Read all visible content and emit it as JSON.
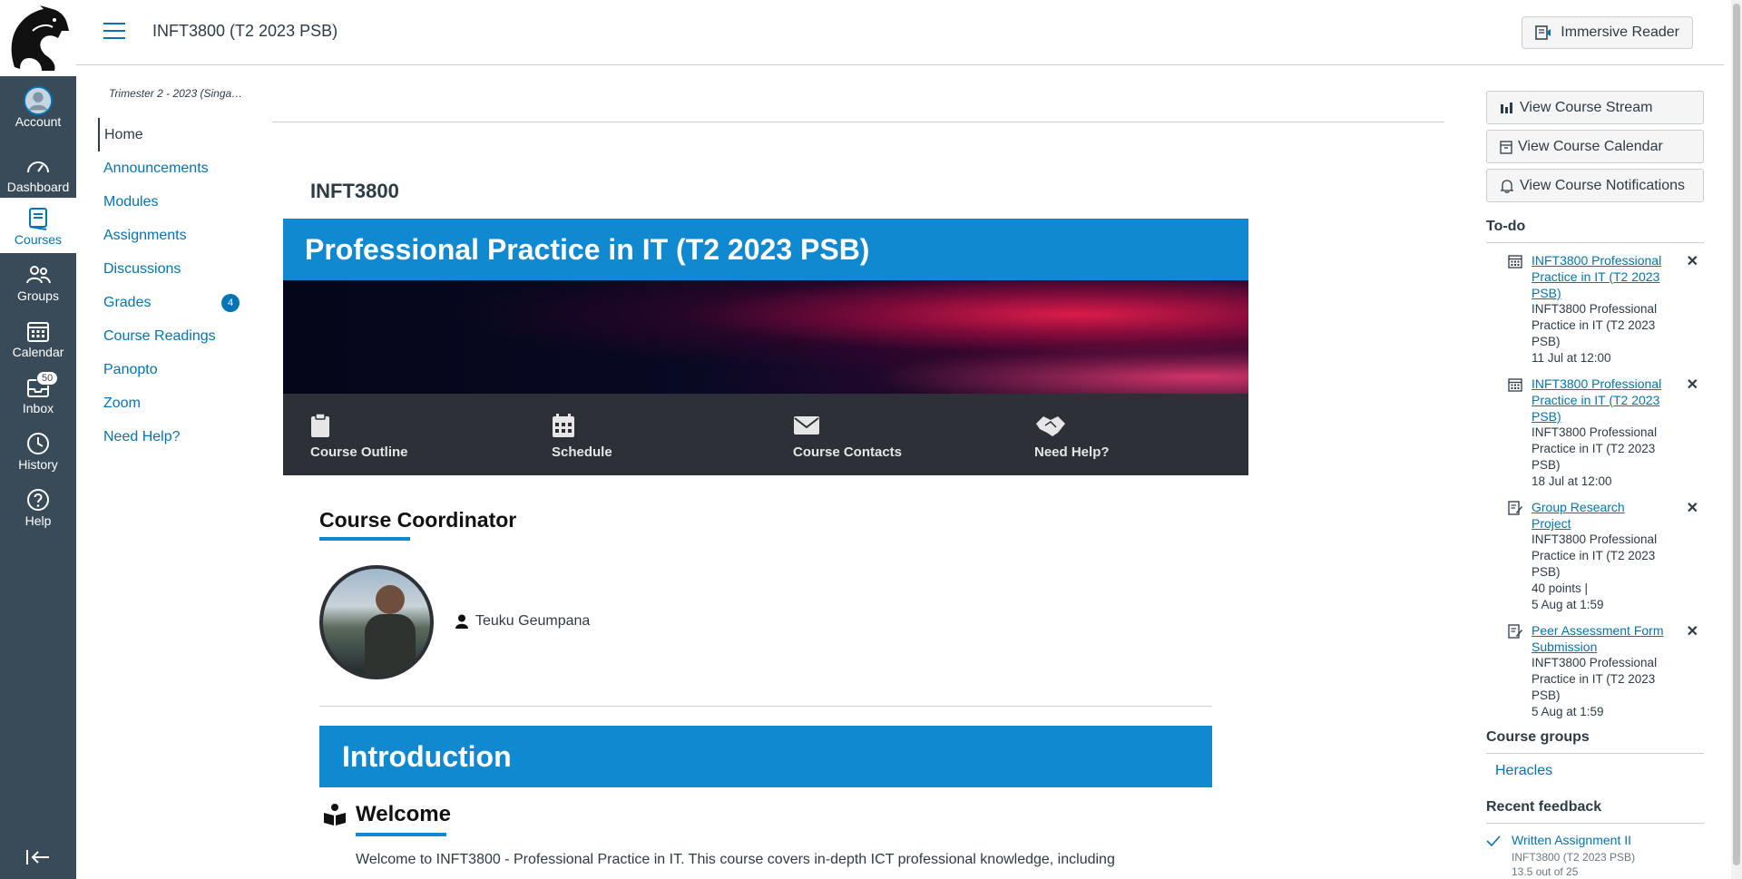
{
  "global_nav": {
    "items": [
      {
        "label": "Account",
        "icon": "account-avatar-icon"
      },
      {
        "label": "Dashboard",
        "icon": "dashboard-icon"
      },
      {
        "label": "Courses",
        "icon": "courses-icon"
      },
      {
        "label": "Groups",
        "icon": "groups-icon"
      },
      {
        "label": "Calendar",
        "icon": "calendar-icon"
      },
      {
        "label": "Inbox",
        "icon": "inbox-icon",
        "badge": "50"
      },
      {
        "label": "History",
        "icon": "history-icon"
      },
      {
        "label": "Help",
        "icon": "help-icon"
      }
    ]
  },
  "header": {
    "course_title": "INFT3800 (T2 2023 PSB)",
    "immersive_reader": "Immersive Reader"
  },
  "course_nav": {
    "term": "Trimester 2 - 2023 (Singap...",
    "items": [
      {
        "label": "Home"
      },
      {
        "label": "Announcements"
      },
      {
        "label": "Modules"
      },
      {
        "label": "Assignments"
      },
      {
        "label": "Discussions"
      },
      {
        "label": "Grades",
        "badge": "4"
      },
      {
        "label": "Course Readings"
      },
      {
        "label": "Panopto"
      },
      {
        "label": "Zoom"
      },
      {
        "label": "Need Help?"
      }
    ]
  },
  "main": {
    "course_code": "INFT3800",
    "banner_title": "Professional Practice in IT (T2 2023 PSB)",
    "banner_nav": [
      {
        "label": "Course Outline",
        "icon": "clipboard-icon"
      },
      {
        "label": "Schedule",
        "icon": "calendar-icon"
      },
      {
        "label": "Course Contacts",
        "icon": "envelope-icon"
      },
      {
        "label": "Need Help?",
        "icon": "handshake-icon"
      }
    ],
    "coordinator_heading": "Course Coordinator",
    "coordinator_name": "Teuku Geumpana",
    "intro_heading": "Introduction",
    "welcome_heading": "Welcome",
    "welcome_text": "Welcome to INFT3800 - Professional Practice in IT. This course covers in-depth ICT professional knowledge, including"
  },
  "sidebar": {
    "buttons": [
      {
        "label": "View Course Stream",
        "icon": "bar-chart-icon"
      },
      {
        "label": "View Course Calendar",
        "icon": "calendar-icon"
      },
      {
        "label": "View Course Notifications",
        "icon": "bell-icon"
      }
    ],
    "todo_heading": "To-do",
    "todos": [
      {
        "link": "INFT3800 Professional Practice in IT (T2 2023 PSB)",
        "course": "INFT3800 Professional Practice in IT (T2 2023 PSB)",
        "points": "",
        "date": "11 Jul at 12:00",
        "icon": "calendar-icon"
      },
      {
        "link": "INFT3800 Professional Practice in IT (T2 2023 PSB)",
        "course": "INFT3800 Professional Practice in IT (T2 2023 PSB)",
        "points": "",
        "date": "18 Jul at 12:00",
        "icon": "calendar-icon"
      },
      {
        "link": "Group Research Project",
        "course": "INFT3800 Professional Practice in IT (T2 2023 PSB)",
        "points": "40 points  |",
        "date": "5 Aug at 1:59",
        "icon": "assignment-icon"
      },
      {
        "link": "Peer Assessment Form Submission",
        "course": "INFT3800 Professional Practice in IT (T2 2023 PSB)",
        "points": "",
        "date": "5 Aug at 1:59",
        "icon": "assignment-icon"
      }
    ],
    "groups_heading": "Course groups",
    "group_name": "Heracles",
    "feedback_heading": "Recent feedback",
    "feedback_item": "Written Assignment II",
    "feedback_course": "INFT3800 (T2 2023 PSB)",
    "feedback_score": "13.5 out of 25"
  }
}
